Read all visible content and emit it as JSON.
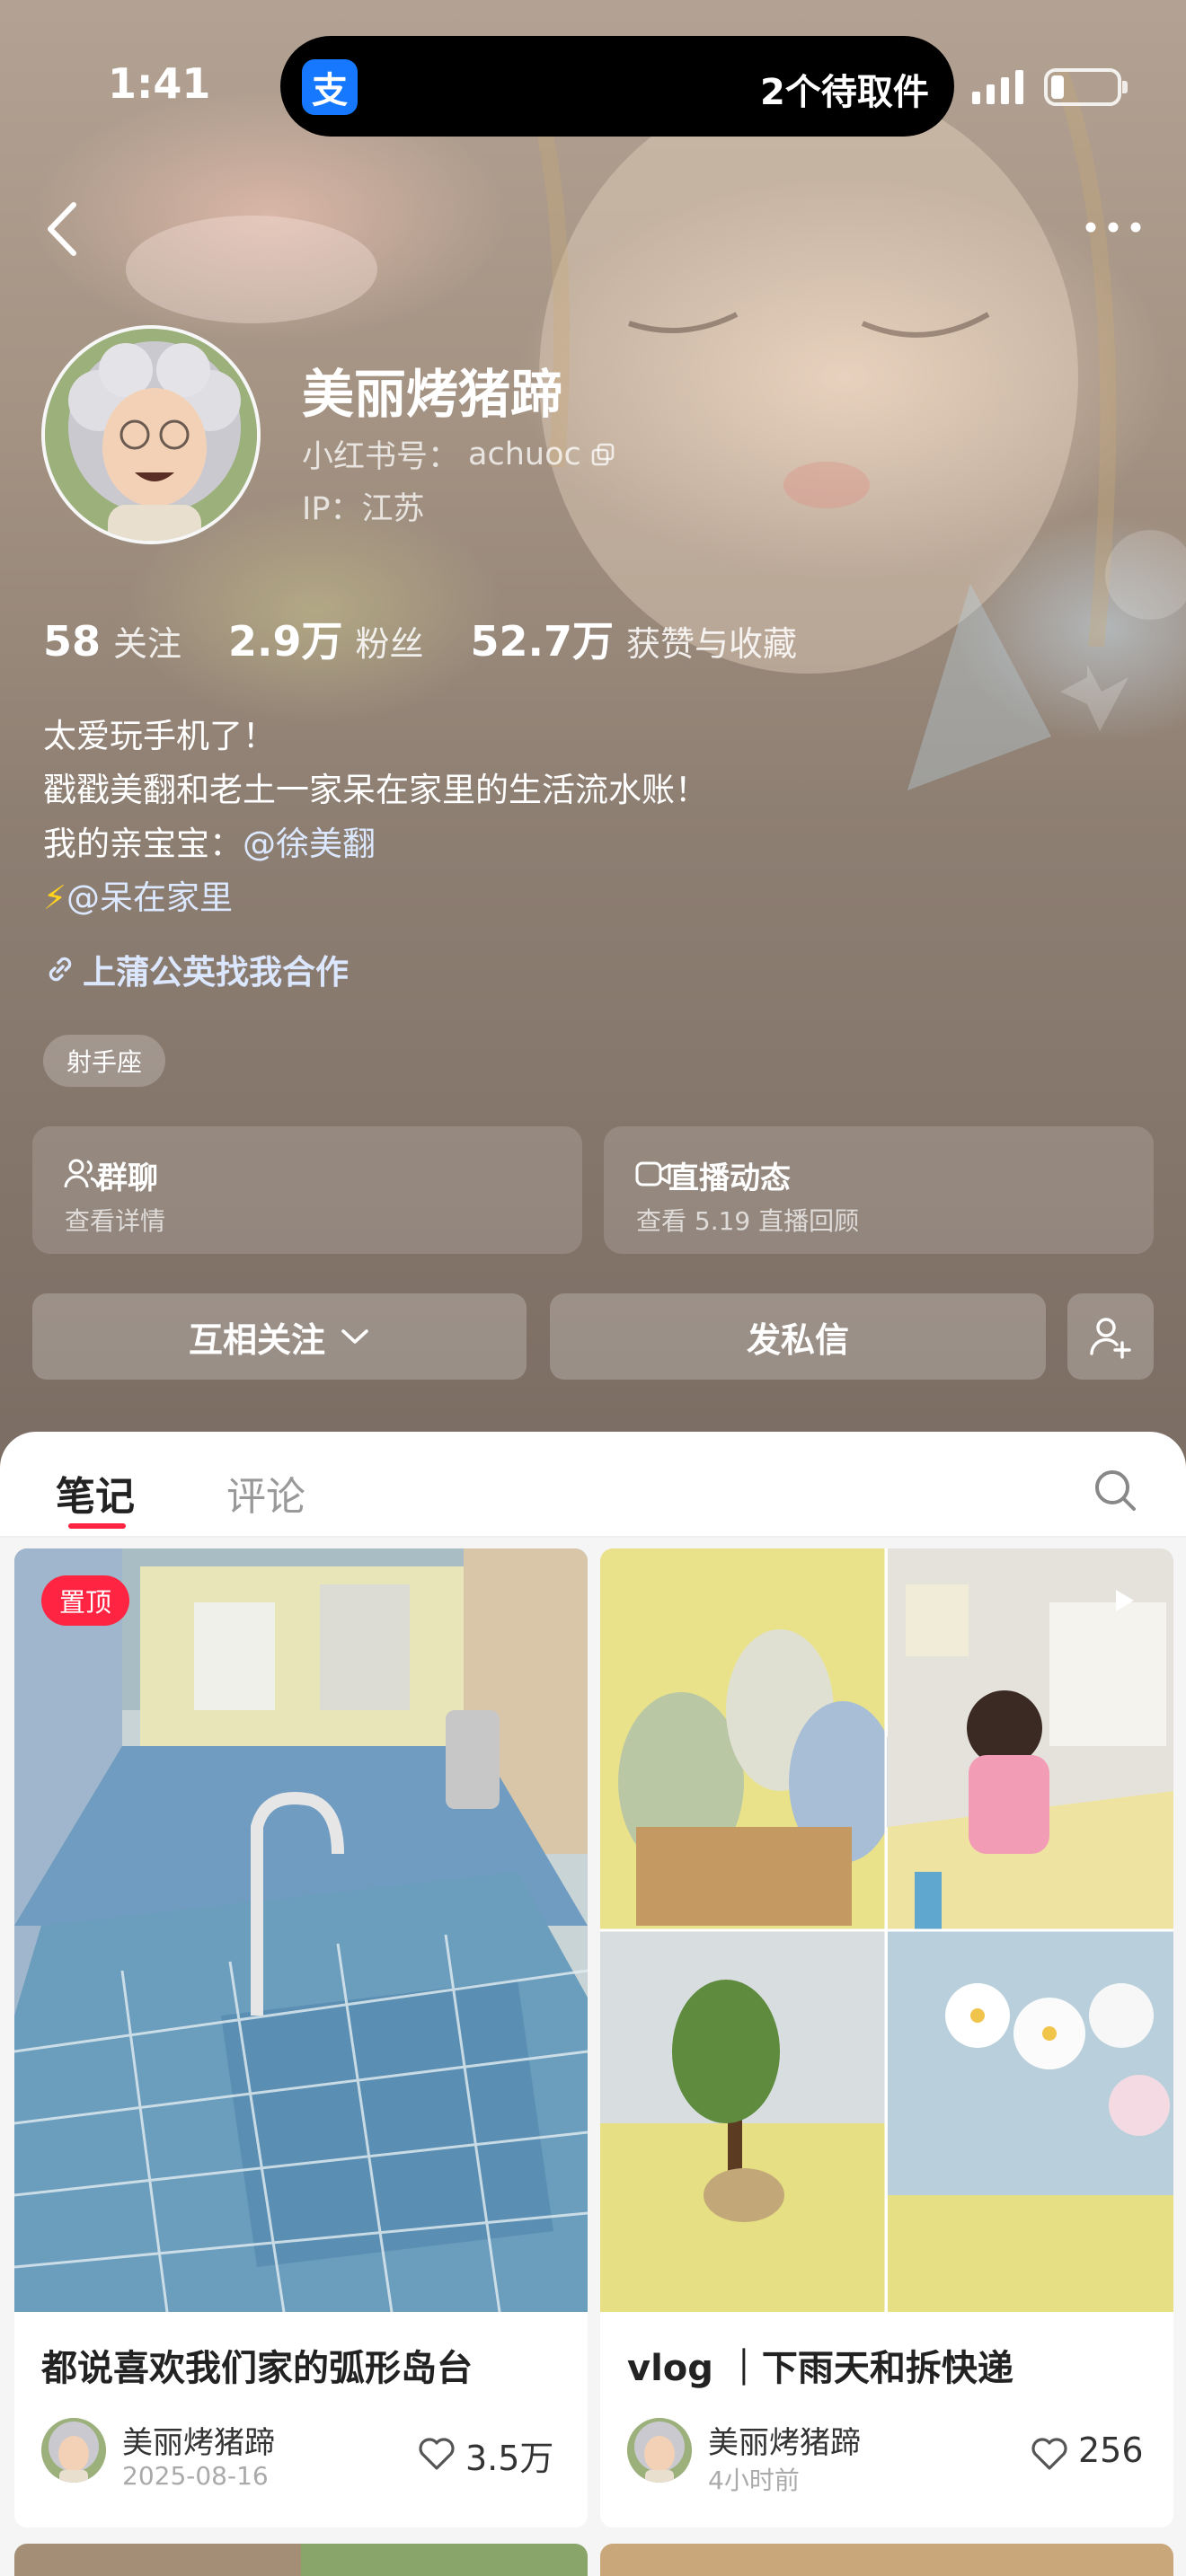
{
  "status_bar": {
    "time": "1:41",
    "pickup_text": "2个待取件",
    "alipay_glyph": "支"
  },
  "profile": {
    "name": "美丽烤猪蹄",
    "id_label": "小红书号：",
    "id_value": "achuoc",
    "ip_label": "IP：",
    "ip_value": "江苏",
    "stats": [
      {
        "value": "58",
        "label": "关注"
      },
      {
        "value": "2.9万",
        "label": "粉丝"
      },
      {
        "value": "52.7万",
        "label": "获赞与收藏"
      }
    ],
    "bio": {
      "line1": "太爱玩手机了！",
      "line2": "戳戳美翻和老土一家呆在家里的生活流水账！",
      "line3_prefix": "我的亲宝宝：",
      "line3_mention": "@徐美翻",
      "line4_emoji": "⚡",
      "line4_mention": "@呆在家里"
    },
    "cooperation_link": "上蒲公英找我合作",
    "zodiac_tag": "射手座"
  },
  "cards": {
    "group_chat": {
      "title": "群聊",
      "subtitle": "查看详情"
    },
    "live": {
      "title": "直播动态",
      "subtitle": "查看 5.19 直播回顾"
    }
  },
  "actions": {
    "follow_label": "互相关注",
    "message_label": "发私信"
  },
  "tabs": [
    {
      "label": "笔记",
      "active": true
    },
    {
      "label": "评论",
      "active": false
    }
  ],
  "notes": [
    {
      "badge": "置顶",
      "title": "都说喜欢我们家的弧形岛台",
      "author": "美丽烤猪蹄",
      "time": "2025-08-16",
      "likes": "3.5万"
    },
    {
      "title": "vlog ｜下雨天和拆快递",
      "author": "美丽烤猪蹄",
      "time": "4小时前",
      "likes": "256"
    }
  ],
  "colors": {
    "accent": "#ff2442",
    "mention": "#dbe8ff",
    "header_overlay": "#8e7f73"
  },
  "icons": [
    "back-icon",
    "more-icon",
    "copy-icon",
    "link-icon",
    "group-icon",
    "live-icon",
    "chevron-down-icon",
    "add-user-icon",
    "search-icon",
    "heart-icon",
    "play-icon"
  ]
}
